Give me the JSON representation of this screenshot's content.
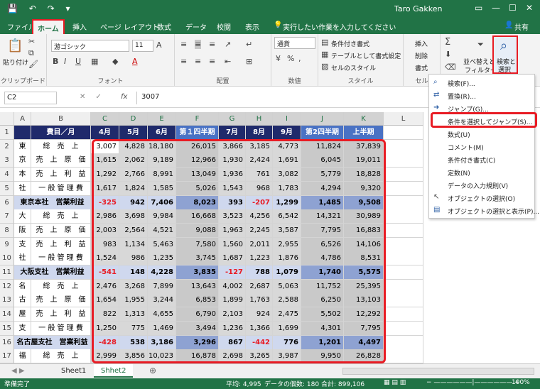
{
  "titlebar": {
    "qa_icons": "save-undo-redo",
    "user": "Taro Gakken",
    "win_min": "—",
    "win_max": "☐",
    "win_close": "✕"
  },
  "menubar": {
    "tabs": [
      "ファイル",
      "ホーム",
      "挿入",
      "ページ レイアウト",
      "数式",
      "データ",
      "校閲",
      "表示"
    ],
    "tell_me": "実行したい作業を入力してください",
    "share": "共有"
  },
  "ribbon": {
    "clipboard": {
      "paste": "貼り付け",
      "label": "クリップボード"
    },
    "font": {
      "name": "游ゴシック",
      "size": "11",
      "label": "フォント"
    },
    "align": {
      "label": "配置"
    },
    "number": {
      "format": "通貨",
      "label": "数値"
    },
    "style": {
      "cond": "条件付き書式",
      "table": "テーブルとして書式設定",
      "cell": "セルのスタイル",
      "label": "スタイル"
    },
    "cells": {
      "insert": "挿入",
      "delete": "削除",
      "format": "書式",
      "label": "セル"
    },
    "edit": {
      "sort": "並べ替えと",
      "filter": "フィルター",
      "search1": "検索と",
      "search2": "選択"
    }
  },
  "formula": {
    "namebox": "C2",
    "fx": "fx",
    "value": "3007"
  },
  "grid": {
    "columns": [
      "A",
      "B",
      "C",
      "D",
      "E",
      "F",
      "G",
      "H",
      "I",
      "J",
      "K",
      "L"
    ],
    "header_row": [
      "",
      "費目／月",
      "4月",
      "5月",
      "6月",
      "第１四半期",
      "7月",
      "8月",
      "9月",
      "第2四半期",
      "上半期"
    ],
    "rows": [
      {
        "n": "2",
        "a": "東",
        "b": "総　売　上",
        "v": [
          "3,007",
          "4,828",
          "18,180",
          "26,015",
          "3,866",
          "3,185",
          "4,773",
          "11,824",
          "37,839"
        ]
      },
      {
        "n": "3",
        "a": "京",
        "b": "売　上　原　価",
        "v": [
          "1,615",
          "2,062",
          "9,189",
          "12,966",
          "1,930",
          "2,424",
          "1,691",
          "6,045",
          "19,011"
        ]
      },
      {
        "n": "4",
        "a": "本",
        "b": "売　上　利　益",
        "v": [
          "1,292",
          "2,766",
          "8,991",
          "13,049",
          "1,936",
          "761",
          "3,082",
          "5,779",
          "18,828"
        ]
      },
      {
        "n": "5",
        "a": "社",
        "b": "一 般 管 理 費",
        "v": [
          "1,617",
          "1,824",
          "1,585",
          "5,026",
          "1,543",
          "968",
          "1,783",
          "4,294",
          "9,320"
        ]
      },
      {
        "n": "6",
        "a": "",
        "b": "東京本社　営業利益",
        "v": [
          "-325",
          "942",
          "7,406",
          "8,023",
          "393",
          "-207",
          "1,299",
          "1,485",
          "9,508"
        ],
        "profit": true
      },
      {
        "n": "7",
        "a": "大",
        "b": "総　売　上",
        "v": [
          "2,986",
          "3,698",
          "9,984",
          "16,668",
          "3,523",
          "4,256",
          "6,542",
          "14,321",
          "30,989"
        ]
      },
      {
        "n": "8",
        "a": "阪",
        "b": "売　上　原　価",
        "v": [
          "2,003",
          "2,564",
          "4,521",
          "9,088",
          "1,963",
          "2,245",
          "3,587",
          "7,795",
          "16,883"
        ]
      },
      {
        "n": "9",
        "a": "支",
        "b": "売　上　利　益",
        "v": [
          "983",
          "1,134",
          "5,463",
          "7,580",
          "1,560",
          "2,011",
          "2,955",
          "6,526",
          "14,106"
        ]
      },
      {
        "n": "10",
        "a": "社",
        "b": "一 般 管 理 費",
        "v": [
          "1,524",
          "986",
          "1,235",
          "3,745",
          "1,687",
          "1,223",
          "1,876",
          "4,786",
          "8,531"
        ]
      },
      {
        "n": "11",
        "a": "",
        "b": "大阪支社　営業利益",
        "v": [
          "-541",
          "148",
          "4,228",
          "3,835",
          "-127",
          "788",
          "1,079",
          "1,740",
          "5,575"
        ],
        "profit": true
      },
      {
        "n": "12",
        "a": "名",
        "b": "総　売　上",
        "v": [
          "2,476",
          "3,268",
          "7,899",
          "13,643",
          "4,002",
          "2,687",
          "5,063",
          "11,752",
          "25,395"
        ]
      },
      {
        "n": "13",
        "a": "古",
        "b": "売　上　原　価",
        "v": [
          "1,654",
          "1,955",
          "3,244",
          "6,853",
          "1,899",
          "1,763",
          "2,588",
          "6,250",
          "13,103"
        ]
      },
      {
        "n": "14",
        "a": "屋",
        "b": "売　上　利　益",
        "v": [
          "822",
          "1,313",
          "4,655",
          "6,790",
          "2,103",
          "924",
          "2,475",
          "5,502",
          "12,292"
        ]
      },
      {
        "n": "15",
        "a": "支",
        "b": "一 般 管 理 費",
        "v": [
          "1,250",
          "775",
          "1,469",
          "3,494",
          "1,236",
          "1,366",
          "1,699",
          "4,301",
          "7,795"
        ]
      },
      {
        "n": "16",
        "a": "",
        "b": "名古屋支社　営業利益",
        "v": [
          "-428",
          "538",
          "3,186",
          "3,296",
          "867",
          "-442",
          "776",
          "1,201",
          "4,497"
        ],
        "profit": true
      },
      {
        "n": "17",
        "a": "福",
        "b": "総　売　上",
        "v": [
          "2,999",
          "3,856",
          "10,023",
          "16,878",
          "2,698",
          "3,265",
          "3,987",
          "9,950",
          "26,828"
        ]
      }
    ]
  },
  "dropdown": {
    "items": [
      "検索(F)...",
      "置換(R)...",
      "ジャンプ(G)...",
      "条件を選択してジャンプ(S)...",
      "数式(U)",
      "コメント(M)",
      "条件付き書式(C)",
      "定数(N)",
      "データの入力規則(V)",
      "オブジェクトの選択(O)",
      "オブジェクトの選択と表示(P)..."
    ]
  },
  "sheets": {
    "tabs": [
      "Sheet1",
      "Shhet2"
    ],
    "add": "⊕"
  },
  "status": {
    "ready": "準備完了",
    "avg": "平均: 4,995",
    "count": "データの個数: 180",
    "sum": "合計: 899,106",
    "zoom": "100%"
  },
  "colors": {
    "excel_green": "#217346",
    "header_navy": "#1f2a6b",
    "quarter_blue": "#4a72c4",
    "highlight_red": "#e81c24"
  }
}
